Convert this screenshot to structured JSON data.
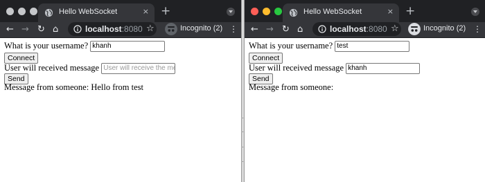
{
  "colors": {
    "titlebar": "#202124",
    "tab_active": "#35363a",
    "toolbar": "#35363a",
    "omnibox": "#202124",
    "traffic_close": "#ff5f57",
    "traffic_minimize": "#febc2e",
    "traffic_zoom": "#28c840",
    "traffic_inactive": "#c5c7ca"
  },
  "left_window": {
    "tab_title": "Hello WebSocket",
    "tab_close": "×",
    "new_tab": "+",
    "nav": {
      "back": "←",
      "forward": "→",
      "reload": "↻",
      "home": "⌂"
    },
    "url_host": "localhost",
    "url_port": ":8080",
    "bookmark_star": "☆",
    "incognito_label": "Incognito (2)",
    "menu": "⋮",
    "page": {
      "username_label": "What is your username?",
      "username_value": "khanh",
      "connect_button": "Connect",
      "recipient_label": "User will received message",
      "recipient_value": "",
      "recipient_placeholder": "User will receive the message",
      "send_button": "Send",
      "message_label": "Message from someone:",
      "message_text": "Hello from test"
    }
  },
  "right_window": {
    "tab_title": "Hello WebSocket",
    "tab_close": "×",
    "new_tab": "+",
    "nav": {
      "back": "←",
      "forward": "→",
      "reload": "↻",
      "home": "⌂"
    },
    "url_host": "localhost",
    "url_port": ":8080",
    "bookmark_star": "☆",
    "incognito_label": "Incognito (2)",
    "menu": "⋮",
    "page": {
      "username_label": "What is your username?",
      "username_value": "test",
      "connect_button": "Connect",
      "recipient_label": "User will received message",
      "recipient_value": "khanh",
      "send_button": "Send",
      "message_label": "Message from someone:",
      "message_text": ""
    }
  }
}
